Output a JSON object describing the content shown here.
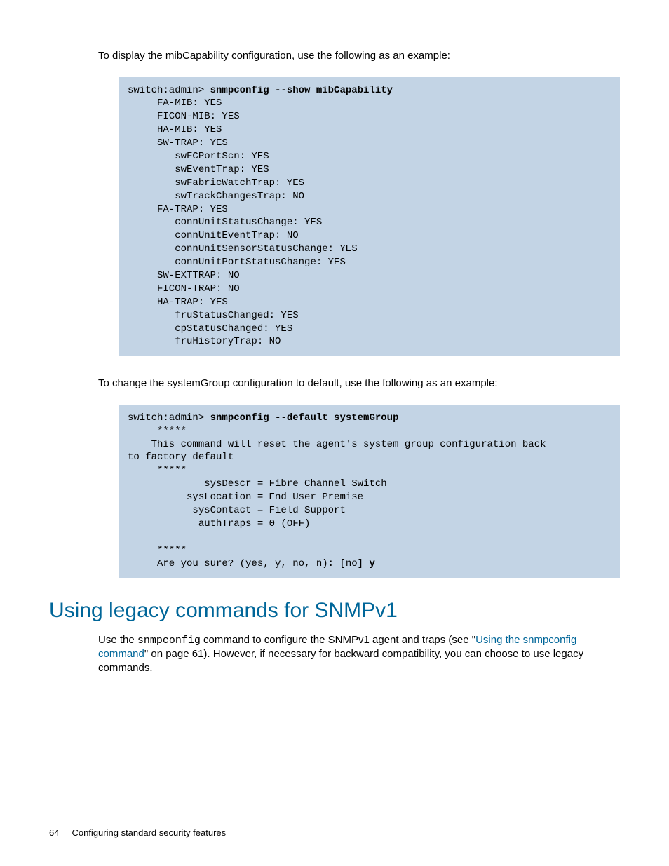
{
  "intro1": "To display the mibCapability configuration, use the following as an example:",
  "code1": {
    "prompt": "switch:admin> ",
    "cmd": "snmpconfig --show mibCapability",
    "body": "     FA-MIB: YES\n     FICON-MIB: YES\n     HA-MIB: YES\n     SW-TRAP: YES\n        swFCPortScn: YES\n        swEventTrap: YES\n        swFabricWatchTrap: YES\n        swTrackChangesTrap: NO\n     FA-TRAP: YES\n        connUnitStatusChange: YES\n        connUnitEventTrap: NO\n        connUnitSensorStatusChange: YES\n        connUnitPortStatusChange: YES\n     SW-EXTTRAP: NO\n     FICON-TRAP: NO\n     HA-TRAP: YES\n        fruStatusChanged: YES\n        cpStatusChanged: YES\n        fruHistoryTrap: NO"
  },
  "intro2": "To change the systemGroup configuration to default, use the following as an example:",
  "code2": {
    "prompt": "switch:admin> ",
    "cmd": "snmpconfig --default systemGroup",
    "body_a": "     *****\n    This command will reset the agent's system group configuration back\nto factory default\n     *****\n             sysDescr = Fibre Channel Switch\n          sysLocation = End User Premise\n           sysContact = Field Support\n            authTraps = 0 (OFF)\n\n     *****\n     Are you sure? (yes, y, no, n): [no] ",
    "confirm": "y"
  },
  "heading": "Using legacy commands for SNMPv1",
  "para": {
    "t1": "Use the ",
    "code": "snmpconfig",
    "t2": " command to configure the SNMPv1 agent and traps (see \"",
    "link": "Using the snmpconfig command",
    "t3": "\" on page 61). However, if necessary for backward compatibility, you can choose to use legacy commands."
  },
  "footer": {
    "page": "64",
    "title": "Configuring standard security features"
  }
}
